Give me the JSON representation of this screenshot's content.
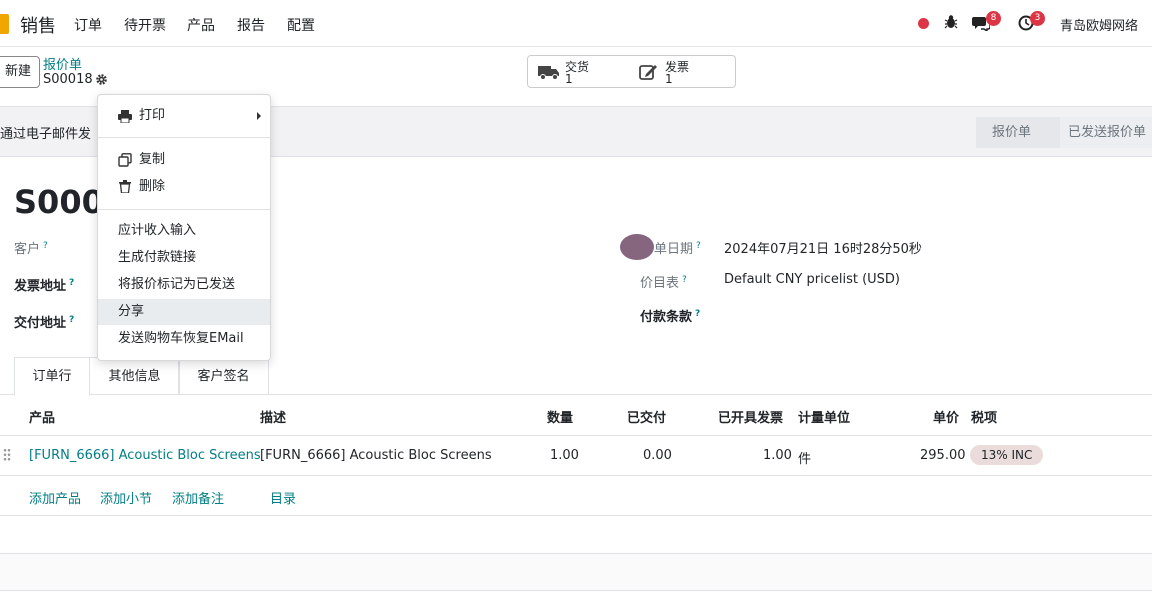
{
  "nav": {
    "app_name": "销售",
    "menu": [
      "订单",
      "待开票",
      "产品",
      "报告",
      "配置"
    ],
    "chat_count": "8",
    "activity_count": "3",
    "company": "青岛欧姆网络"
  },
  "control": {
    "new_label": "新建",
    "breadcrumb": "报价单",
    "record": "S00018",
    "delivery_label": "交货",
    "delivery_count": "1",
    "invoice_label": "发票",
    "invoice_count": "1"
  },
  "statusbar": {
    "send_email_label": "通过电子邮件发",
    "stages": [
      "报价单",
      "已发送报价单"
    ]
  },
  "form": {
    "title": "S0001",
    "customer_label": "客户",
    "invoice_address_label": "发票地址",
    "delivery_address_label": "交付地址",
    "order_date_label": "单日期",
    "order_date_value": "2024年07月21日 16时28分50秒",
    "pricelist_label": "价目表",
    "pricelist_value": "Default CNY pricelist (USD)",
    "payment_terms_label": "付款条款",
    "help_mark": "?"
  },
  "tabs": [
    "订单行",
    "其他信息",
    "客户签名"
  ],
  "table": {
    "headers": [
      "产品",
      "描述",
      "数量",
      "已交付",
      "已开具发票",
      "计量单位",
      "单价",
      "税项"
    ],
    "rows": [
      {
        "product": "[FURN_6666] Acoustic Bloc Screens",
        "description": "[FURN_6666] Acoustic Bloc Screens",
        "quantity": "1.00",
        "delivered": "0.00",
        "invoiced": "1.00",
        "uom": "件",
        "price": "295.00",
        "tax": "13% INC"
      }
    ],
    "actions": [
      "添加产品",
      "添加小节",
      "添加备注",
      "目录"
    ]
  },
  "gear_menu": {
    "print": "打印",
    "duplicate": "复制",
    "delete": "删除",
    "items": [
      "应计收入输入",
      "生成付款链接",
      "将报价标记为已发送",
      "分享",
      "发送购物车恢复EMail"
    ]
  },
  "colors": {
    "accent": "#017e84",
    "brand": "#714b67",
    "badge": "#dc3545"
  }
}
